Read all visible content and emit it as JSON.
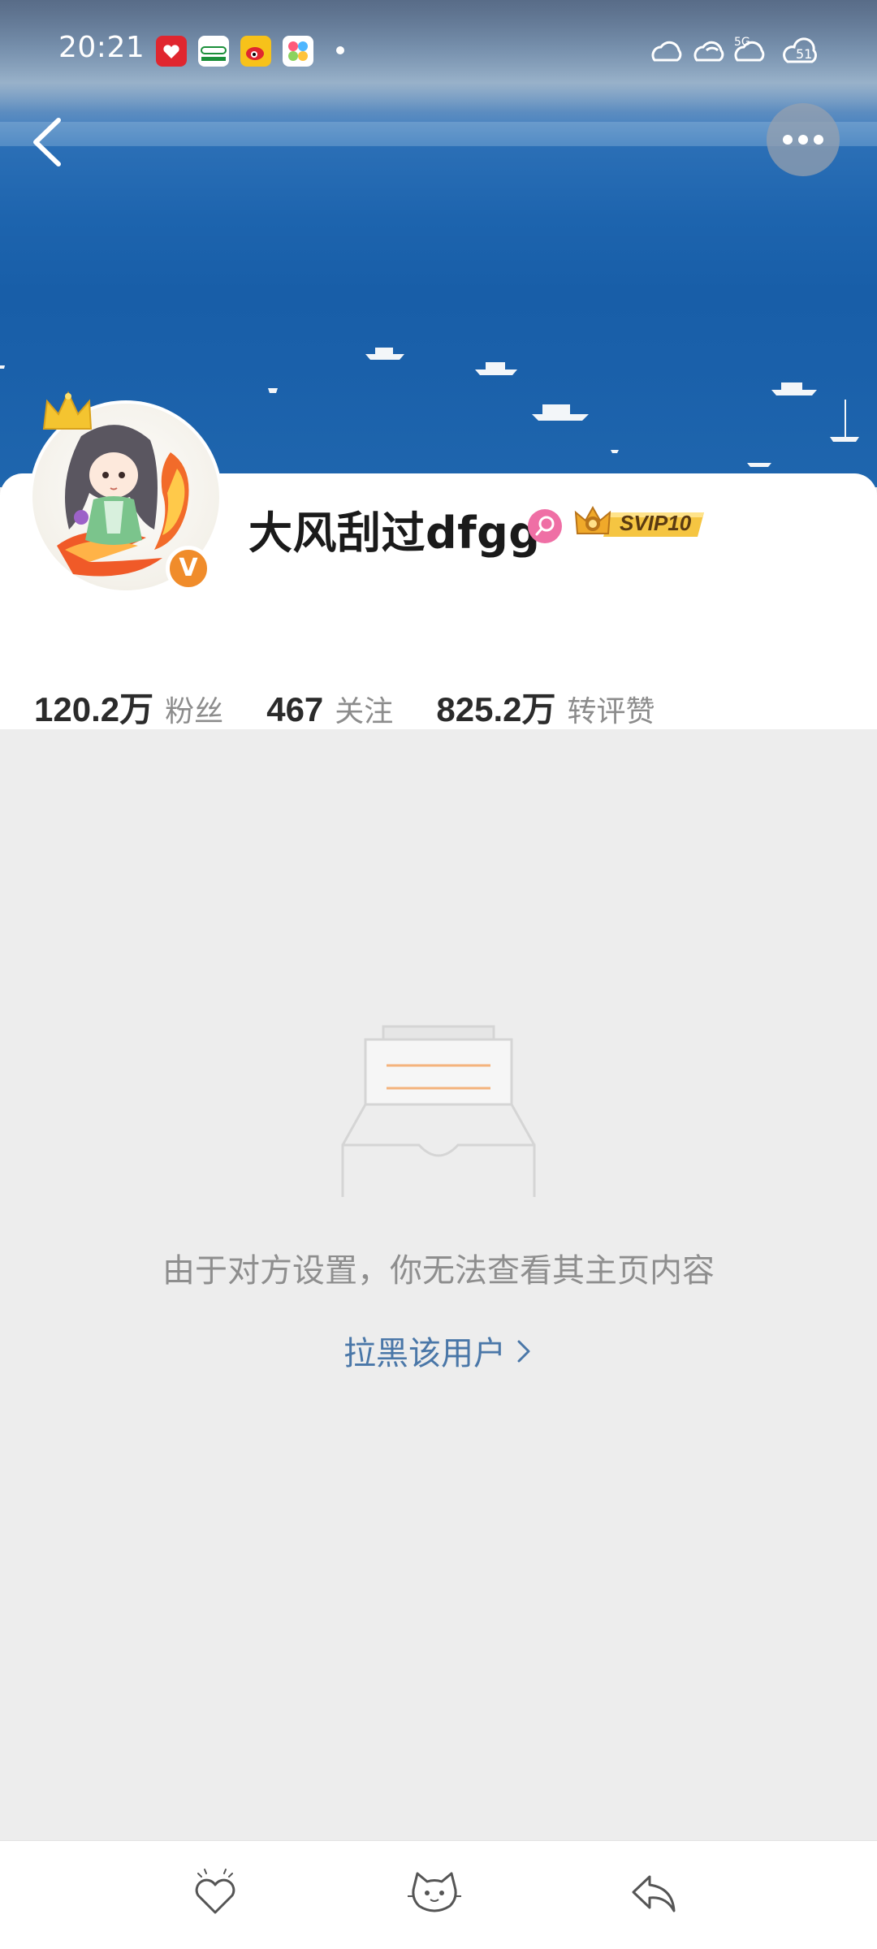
{
  "status_bar": {
    "time": "20:21",
    "app_icons": [
      "pinduoduo-icon",
      "oppo-icon",
      "weibo-icon",
      "app-icon"
    ],
    "network": "5G",
    "battery": "51"
  },
  "header": {
    "back_icon": "chevron-left-icon",
    "more_icon": "more-dots-icon"
  },
  "profile": {
    "username": "大风刮过dfgg",
    "gender_icon": "female-icon",
    "badge": "SVIP10",
    "verified_label": "V",
    "accent_color": "#f08c2b"
  },
  "stats": [
    {
      "value": "120.2万",
      "label": "粉丝"
    },
    {
      "value": "467",
      "label": "关注"
    },
    {
      "value": "825.2万",
      "label": "转评赞"
    }
  ],
  "empty_state": {
    "message": "由于对方设置，你无法查看其主页内容",
    "action_label": "拉黑该用户",
    "action_color": "#4a77a8"
  },
  "bottom_bar": {
    "buttons": [
      "heart-icon",
      "cat-icon",
      "reply-icon"
    ]
  }
}
